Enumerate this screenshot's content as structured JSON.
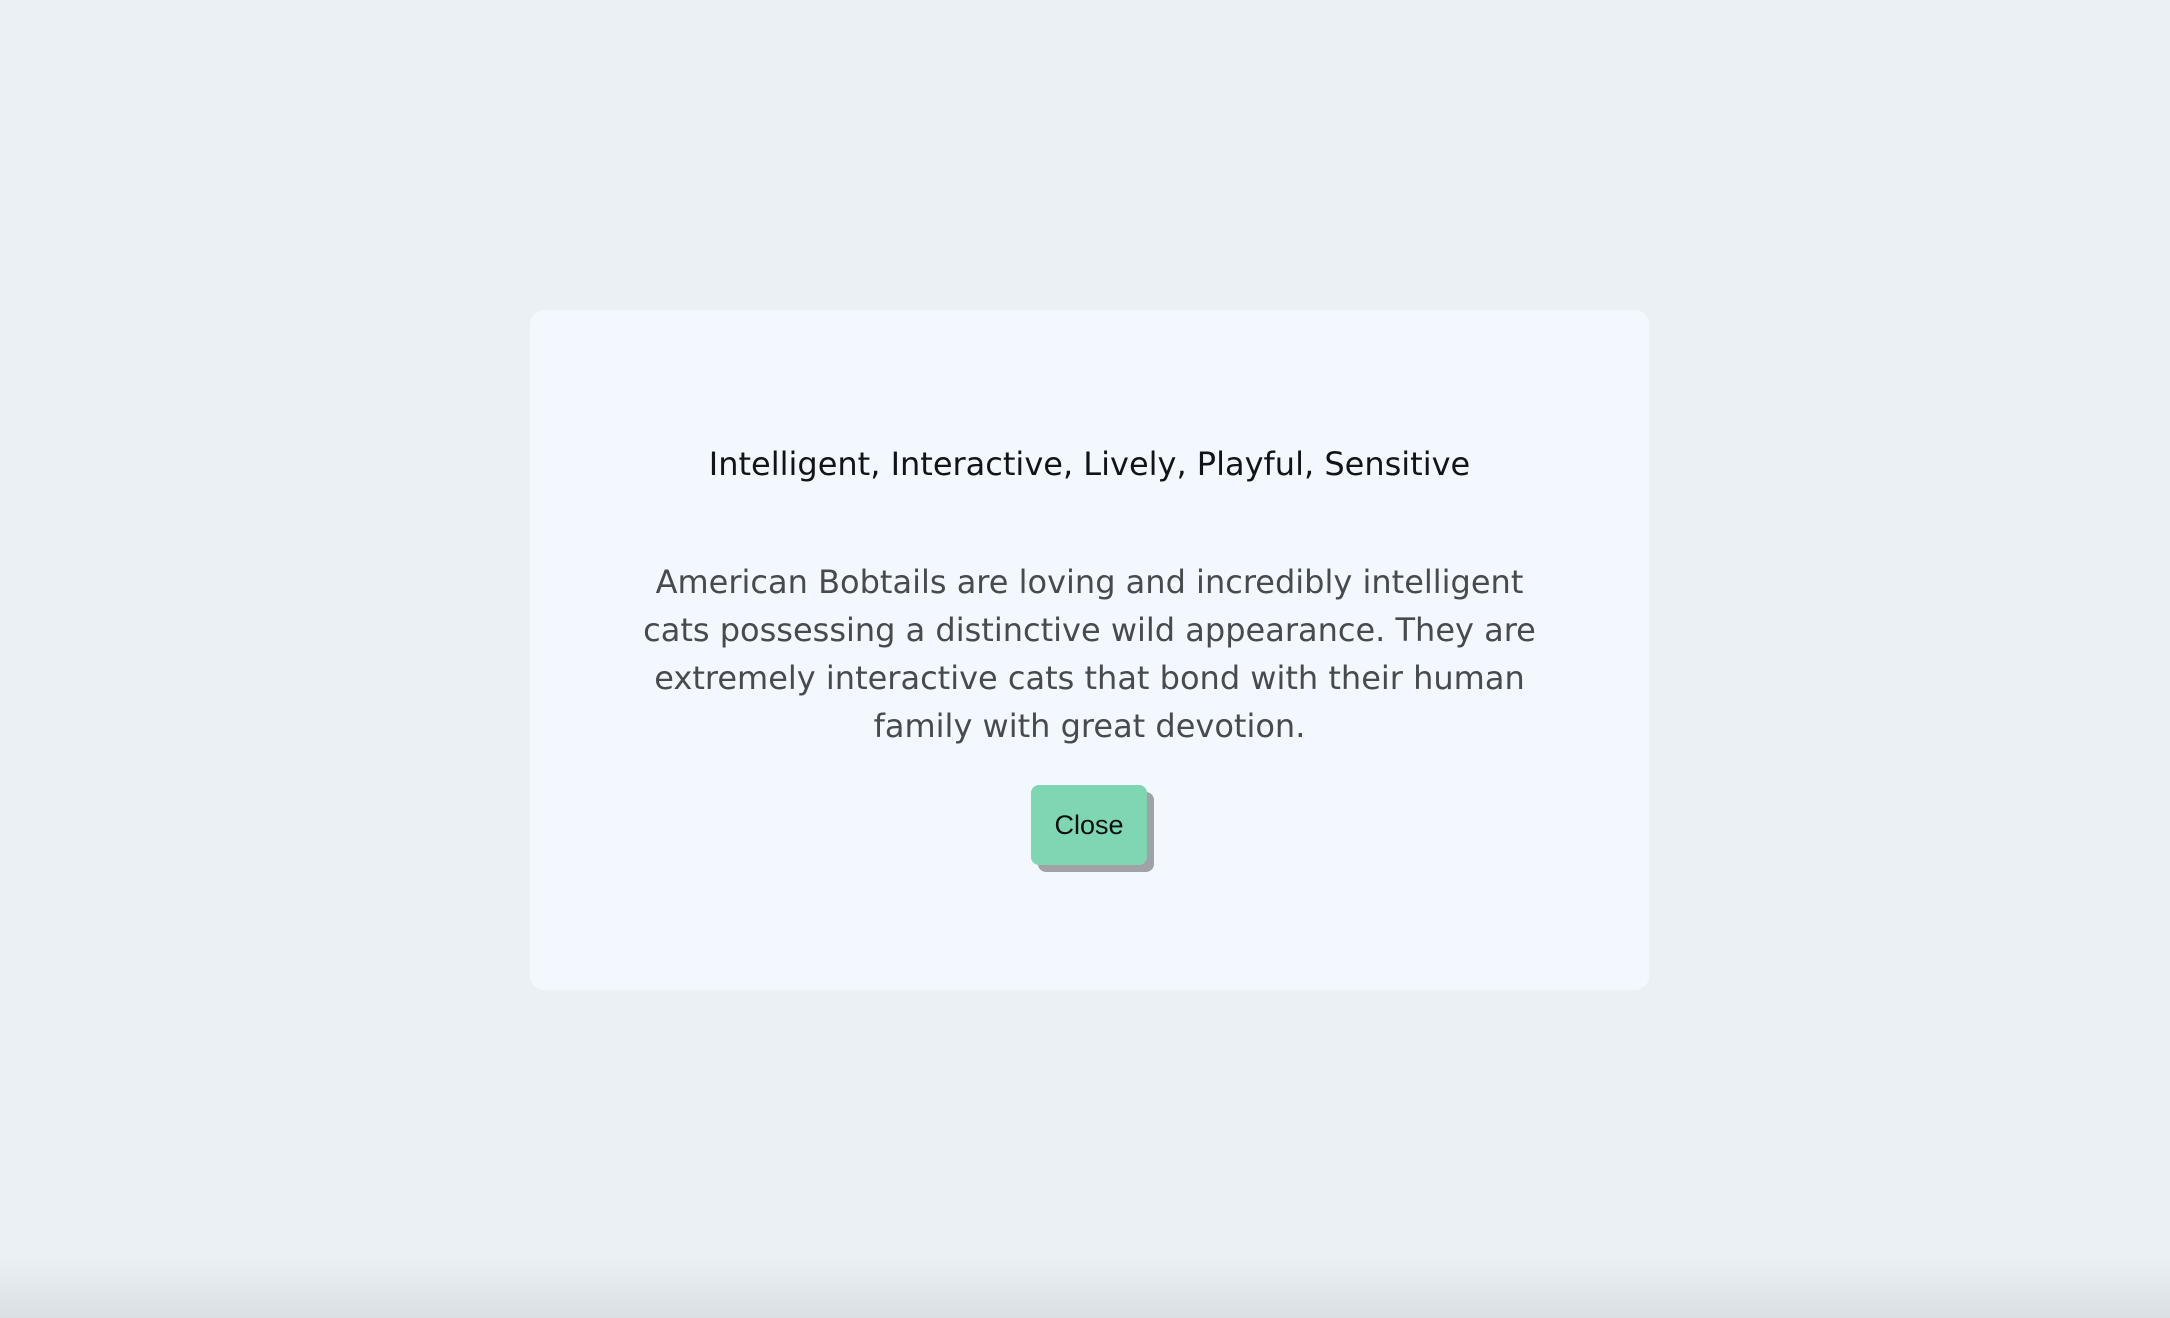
{
  "modal": {
    "title": "Intelligent, Interactive, Lively, Playful, Sensitive",
    "description": "American Bobtails are loving and incredibly intelligent cats possessing a distinctive wild appearance. They are extremely interactive cats that bond with their human family with great devotion.",
    "close_label": "Close"
  },
  "colors": {
    "background": "#ebf0f4",
    "modal_background": "#f2f8fd",
    "button_accent": "#7ed6b2",
    "button_shadow": "#a1a2a6"
  }
}
